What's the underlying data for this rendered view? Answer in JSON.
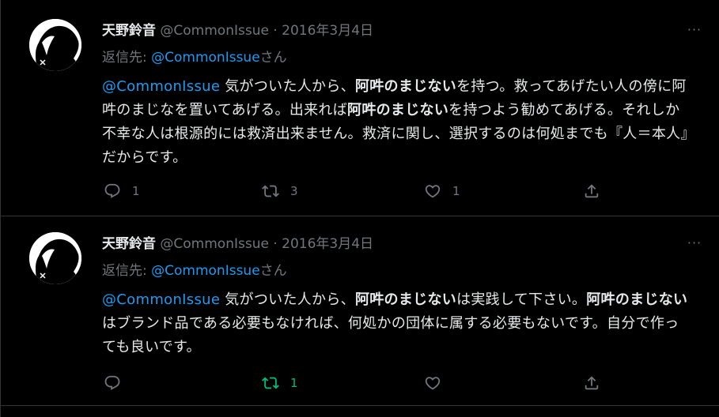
{
  "tweets": [
    {
      "name": "天野鈴音",
      "handle": "@CommonIssue",
      "separator": "·",
      "date": "2016年3月4日",
      "more": "···",
      "reply_prefix": "返信先: ",
      "reply_handle": "@CommonIssue",
      "reply_suffix": "さん",
      "body": {
        "mention": "@CommonIssue",
        "t1": " 気がついた人から、",
        "b1": "阿吽のまじない",
        "t2": "を持つ。救ってあげたい人の傍に阿吽のまじなを置いてあげる。出来れば",
        "b2": "阿吽のまじない",
        "t3": "を持つよう勧めてあげる。それしか不幸な人は根源的には救済出来ません。救済に関し、選択するのは何処までも『人＝本人』だからです。"
      },
      "actions": {
        "replies": "1",
        "retweets": "3",
        "likes": "1"
      }
    },
    {
      "name": "天野鈴音",
      "handle": "@CommonIssue",
      "separator": "·",
      "date": "2016年3月4日",
      "more": "···",
      "reply_prefix": "返信先: ",
      "reply_handle": "@CommonIssue",
      "reply_suffix": "さん",
      "body": {
        "mention": "@CommonIssue",
        "t1": " 気がついた人から、",
        "b1": "阿吽のまじない",
        "t2": "は実践して下さい。",
        "b2": "阿吽のまじない",
        "t3": "はブランド品である必要もなければ、何処かの団体に属する必要もないです。自分で作っても良いです。"
      },
      "actions": {
        "replies": "",
        "retweets": "1",
        "likes": ""
      }
    }
  ],
  "icons": {
    "reply": "reply-icon",
    "retweet": "retweet-icon",
    "like": "heart-icon",
    "share": "share-icon",
    "more": "more-icon"
  },
  "colors": {
    "background": "#000000",
    "text": "#e7e9ea",
    "secondary": "#71767b",
    "link": "#1d9bf0",
    "retweet_active": "#00ba7c",
    "divider": "#2f3336"
  }
}
